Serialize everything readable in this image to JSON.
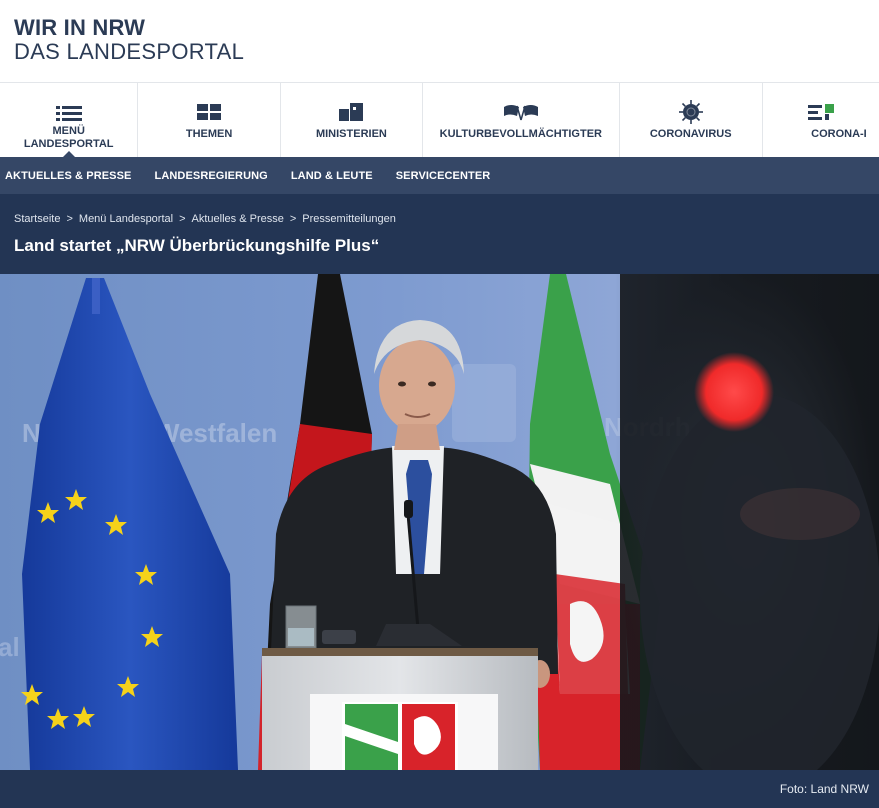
{
  "logo": {
    "line1": "WIR IN NRW",
    "line2": "DAS LANDESPORTAL"
  },
  "icon_nav": [
    {
      "label_top": "MENÜ",
      "label": "LANDESPORTAL",
      "icon": "menu-list-icon",
      "active": true
    },
    {
      "label": "THEMEN",
      "icon": "grid-icon"
    },
    {
      "label": "MINISTERIEN",
      "icon": "building-icon"
    },
    {
      "label": "KULTURBEVOLLMÄCHTIGTER",
      "icon": "flags-icon"
    },
    {
      "label": "CORONAVIRUS",
      "icon": "virus-icon"
    },
    {
      "label": "CORONA-I",
      "icon": "corona-info-icon"
    }
  ],
  "sub_nav": [
    "AKTUELLES & PRESSE",
    "LANDESREGIERUNG",
    "LAND & LEUTE",
    "SERVICECENTER"
  ],
  "breadcrumb": [
    "Startseite",
    "Menü Landesportal",
    "Aktuelles & Presse",
    "Pressemitteilungen"
  ],
  "breadcrumb_separator": ">",
  "page_title": "Land startet „NRW Überbrückungshilfe Plus“",
  "hero": {
    "backdrop_text_left": "Nordrhein-Westfalen",
    "backdrop_text_right": "Nordrh",
    "backdrop_text_far_left": "al"
  },
  "caption": "Foto: Land NRW",
  "colors": {
    "navy": "#233554",
    "subnav": "#354766",
    "text": "#2b3b55",
    "eu_blue": "#1f47a8",
    "nrw_green": "#3aa14a",
    "nrw_red": "#d8232a"
  }
}
